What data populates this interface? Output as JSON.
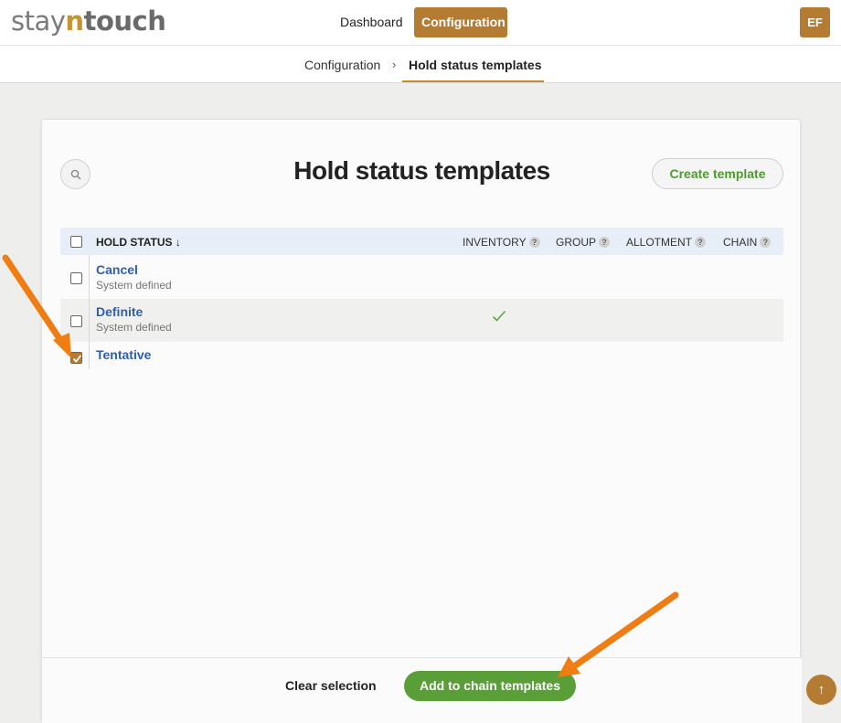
{
  "header": {
    "logo": {
      "part1": "stay",
      "part2": "n",
      "part3": "touch"
    },
    "nav": {
      "dashboard": "Dashboard",
      "configuration": "Configuration"
    },
    "avatar_initials": "EF",
    "active_color": "#b47b32"
  },
  "breadcrumb": {
    "parent": "Configuration",
    "separator": "›",
    "current": "Hold status templates"
  },
  "page": {
    "title": "Hold status templates",
    "create_button": "Create template"
  },
  "table": {
    "columns": {
      "hold_status": "HOLD STATUS ↓",
      "inventory": "INVENTORY",
      "group": "GROUP",
      "allotment": "ALLOTMENT",
      "chain": "CHAIN",
      "help": "?"
    },
    "rows": [
      {
        "name": "Cancel",
        "sub": "System defined",
        "checked": false,
        "inventory": false
      },
      {
        "name": "Definite",
        "sub": "System defined",
        "checked": false,
        "inventory": true
      },
      {
        "name": "Tentative",
        "sub": "",
        "checked": true,
        "inventory": false
      }
    ]
  },
  "footer": {
    "clear_label": "Clear selection",
    "add_label": "Add to chain templates"
  },
  "scroll_top_icon": "↑"
}
